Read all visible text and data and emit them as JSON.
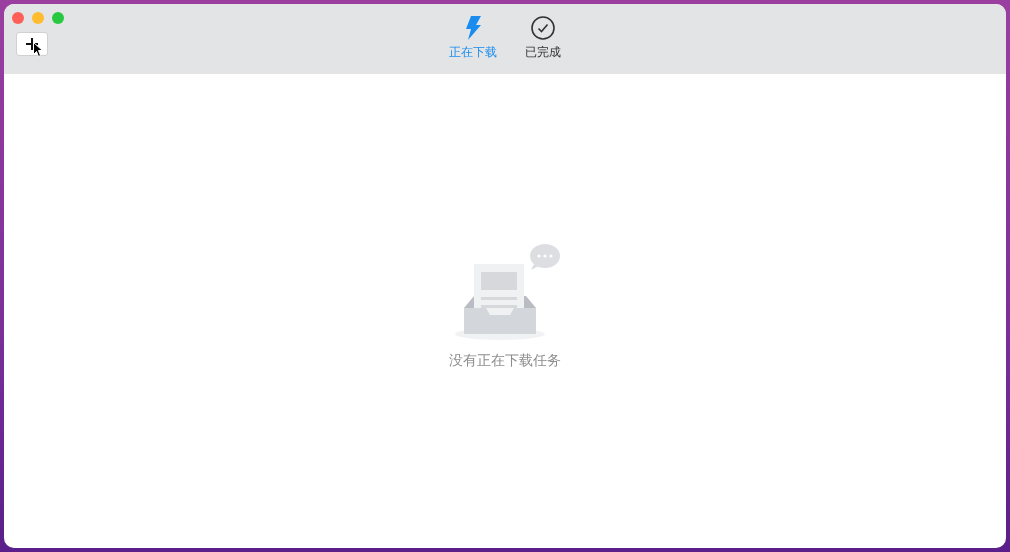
{
  "tabs": [
    {
      "label": "正在下载",
      "kind": "bolt",
      "selected": true
    },
    {
      "label": "已完成",
      "kind": "check",
      "selected": false
    }
  ],
  "empty_state": {
    "message": "没有正在下载任务"
  }
}
